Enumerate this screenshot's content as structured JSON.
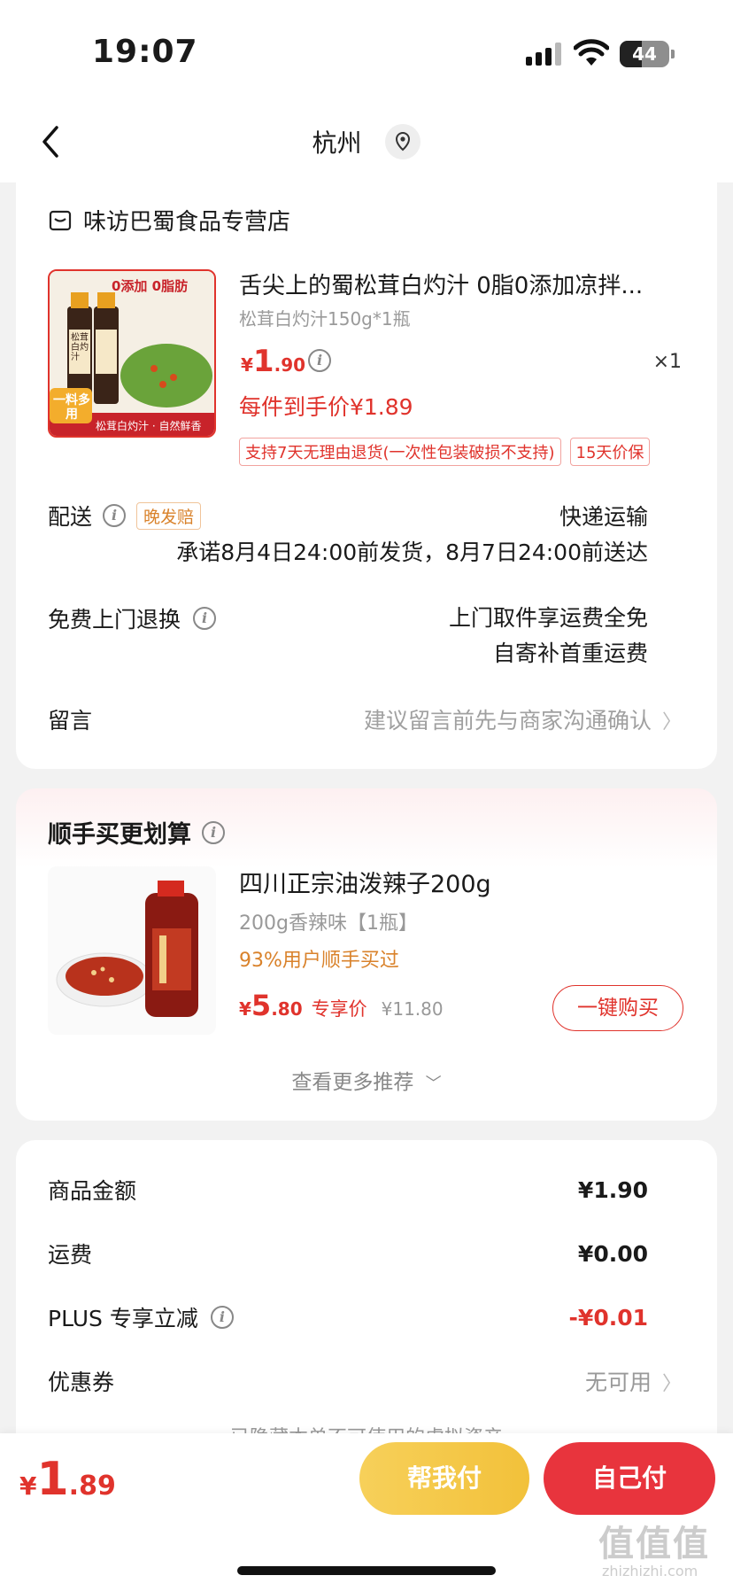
{
  "status_bar": {
    "time": "19:07",
    "battery": "44"
  },
  "nav": {
    "title": "杭州"
  },
  "order": {
    "store_name": "味访巴蜀食品专营店",
    "product": {
      "title": "舌尖上的蜀松茸白灼汁 0脂0添加凉拌...",
      "spec": "松茸白灼汁150g*1瓶",
      "price_currency": "¥",
      "price_int": "1",
      "price_dec": ".90",
      "quantity": "×1",
      "unit_price": "每件到手价¥1.89",
      "tags": [
        "支持7天无理由退货(一次性包装破损不支持)",
        "15天价保"
      ],
      "image_text": {
        "top1": "0添加",
        "top2": "0脂肪",
        "badge": "一料多用",
        "bottom": "松茸白灼汁 · 自然鲜香",
        "bottle": "松茸白灼汁"
      }
    },
    "delivery": {
      "label": "配送",
      "badge": "晚发赔",
      "method": "快递运输",
      "promise": "承诺8月4日24:00前发货，8月7日24:00前送达"
    },
    "return": {
      "label": "免费上门退换",
      "line1": "上门取件享运费全免",
      "line2": "自寄补首重运费"
    },
    "message": {
      "label": "留言",
      "placeholder": "建议留言前先与商家沟通确认"
    }
  },
  "recommend": {
    "title": "顺手买更划算",
    "item": {
      "name": "四川正宗油泼辣子200g",
      "spec": "200g香辣味【1瓶】",
      "bought": "93%用户顺手买过",
      "price_currency": "¥",
      "price_int": "5",
      "price_dec": ".80",
      "exclusive": "专享价",
      "original": "¥11.80",
      "buy_label": "一键购买"
    },
    "more": "查看更多推荐"
  },
  "summary": {
    "goods_label": "商品金额",
    "goods_value": "¥1.90",
    "freight_label": "运费",
    "freight_value": "¥0.00",
    "plus_label": "PLUS 专享立减",
    "plus_value": "-¥0.01",
    "coupon_label": "优惠券",
    "coupon_value": "无可用",
    "hidden_note": "已隐藏本单不可使用的虚拟资产"
  },
  "bottom_bar": {
    "total_currency": "¥",
    "total_int": "1",
    "total_dec": ".89",
    "help_pay": "帮我付",
    "self_pay": "自己付",
    "watermark": "值值值",
    "watermark_url": "zhizhizhi.com"
  },
  "colors": {
    "accent_red": "#e0332c",
    "pay_red": "#e8343d",
    "help_yellow": "#f2c13a",
    "orange": "#d9822b"
  }
}
